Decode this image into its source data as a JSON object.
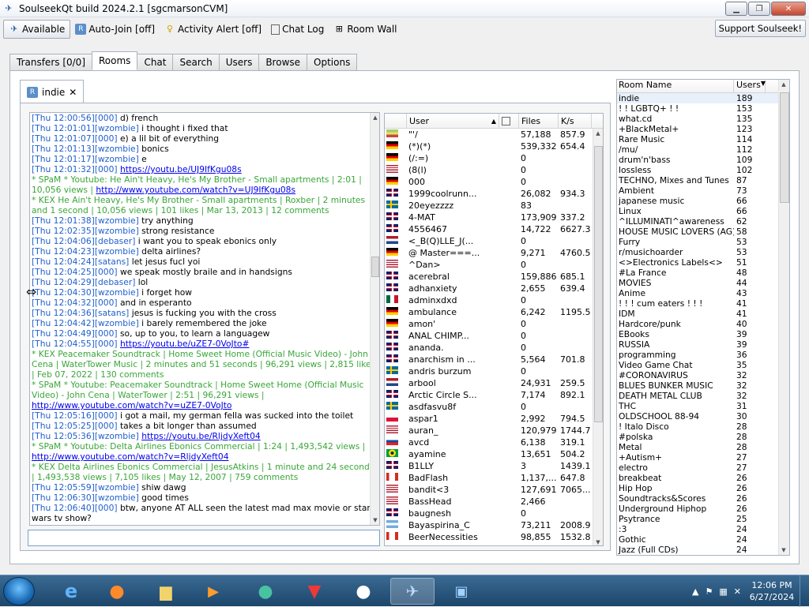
{
  "window": {
    "title": "SoulseekQt build 2024.2.1 [sgcmarsonCVM]",
    "controls": {
      "minimize": "▁",
      "maximize": "❐",
      "close": "✕"
    }
  },
  "toolbar": {
    "status": "Available",
    "autojoin": "Auto-Join [off]",
    "alert": "Activity Alert [off]",
    "chatlog": "Chat Log",
    "roomwall": "Room Wall",
    "support": "Support Soulseek!"
  },
  "tabs": [
    "Transfers [0/0]",
    "Rooms",
    "Chat",
    "Search",
    "Users",
    "Browse",
    "Options"
  ],
  "active_tab": "Rooms",
  "room_tab": {
    "name": "indie",
    "close": "✕"
  },
  "chat_lines": [
    {
      "t": "[Thu 12:00:56]",
      "n": "[000]",
      "m": " d) french"
    },
    {
      "t": "[Thu 12:01:01]",
      "n": "[wzombie]",
      "m": " i thought i fixed that"
    },
    {
      "t": "[Thu 12:01:07]",
      "n": "[000]",
      "m": " e) a lil bit of everything"
    },
    {
      "t": "[Thu 12:01:13]",
      "n": "[wzombie]",
      "m": " bonics"
    },
    {
      "t": "[Thu 12:01:17]",
      "n": "[wzombie]",
      "m": " e"
    },
    {
      "t": "[Thu 12:01:32]",
      "n": "[000]",
      "m": " ",
      "l": "https://youtu.be/UJ9IfKgu08s"
    },
    {
      "s": "* SPaM * Youtube: He Ain't Heavy, He's My Brother - Small apartments | 2:01 | 10,056 views | ",
      "l": "http://www.youtube.com/watch?v=UJ9IfKgu08s"
    },
    {
      "s": "* KEX He Ain't Heavy, He's My Brother - Small apartments | Roxber | 2 minutes and 1 second | 10,056 views | 101 likes | Mar 13, 2013 | 12 comments"
    },
    {
      "t": "[Thu 12:01:38]",
      "n": "[wzombie]",
      "m": " try anything"
    },
    {
      "t": "[Thu 12:02:35]",
      "n": "[wzombie]",
      "m": " strong resistance"
    },
    {
      "t": "[Thu 12:04:06]",
      "n": "[debaser]",
      "m": " i want you to speak ebonics only"
    },
    {
      "t": "[Thu 12:04:23]",
      "n": "[wzombie]",
      "m": " delta airlines?"
    },
    {
      "t": "[Thu 12:04:24]",
      "n": "[satans]",
      "m": " let jesus fucl yoi"
    },
    {
      "t": "[Thu 12:04:25]",
      "n": "[000]",
      "m": " we speak mostly braile and in handsigns"
    },
    {
      "t": "[Thu 12:04:29]",
      "n": "[debaser]",
      "m": " lol"
    },
    {
      "t": "[Thu 12:04:30]",
      "n": "[wzombie]",
      "m": " i forget how"
    },
    {
      "t": "[Thu 12:04:32]",
      "n": "[000]",
      "m": " and in esperanto"
    },
    {
      "t": "[Thu 12:04:36]",
      "n": "[satans]",
      "m": " jesus is fucking you with the cross"
    },
    {
      "t": "[Thu 12:04:42]",
      "n": "[wzombie]",
      "m": " i barely remembered the joke"
    },
    {
      "t": "[Thu 12:04:49]",
      "n": "[000]",
      "m": " so, up to you, to learn a languagew"
    },
    {
      "t": "[Thu 12:04:55]",
      "n": "[000]",
      "m": " ",
      "l": "https://youtu.be/uZE7-0VoJto#"
    },
    {
      "s": "* KEX Peacemaker Soundtrack | Home Sweet Home (Official Music Video) - John Cena | WaterTower Music | 2 minutes and 51 seconds | 96,291 views | 2,815 likes | Feb 07, 2022 | 130 comments"
    },
    {
      "s": "* SPaM * Youtube: Peacemaker Soundtrack | Home Sweet Home (Official Music Video) - John Cena | WaterTower | 2:51 | 96,291 views | ",
      "l": "http://www.youtube.com/watch?v=uZE7-0VoJto"
    },
    {
      "t": "[Thu 12:05:16]",
      "n": "[000]",
      "m": " i got a mail, my german fella was sucked into the toilet"
    },
    {
      "t": "[Thu 12:05:25]",
      "n": "[000]",
      "m": " takes a bit longer than assumed"
    },
    {
      "t": "[Thu 12:05:36]",
      "n": "[wzombie]",
      "m": " ",
      "l": "https://youtu.be/RljdyXeft04"
    },
    {
      "s": "* SPaM * Youtube: Delta Airlines Ebonics Commercial | 1:24 | 1,493,542 views | ",
      "l": "http://www.youtube.com/watch?v=RljdyXeft04"
    },
    {
      "s": "* KEX Delta Airlines Ebonics Commercial | JesusAtkins | 1 minute and 24 seconds | 1,493,538 views | 7,105 likes | May 12, 2007 | 759 comments"
    },
    {
      "t": "[Thu 12:05:59]",
      "n": "[wzombie]",
      "m": " shiw dawg"
    },
    {
      "t": "[Thu 12:06:30]",
      "n": "[wzombie]",
      "m": " good times"
    },
    {
      "t": "[Thu 12:06:40]",
      "n": "[000]",
      "m": " btw, anyone AT ALL seen the latest mad max movie or star wars tv show?"
    }
  ],
  "users_headers": {
    "user": "User",
    "files": "Files",
    "speed": "K/s"
  },
  "users": [
    {
      "f": "#",
      "u": "\"'/",
      "fi": "57,188",
      "k": "857.9"
    },
    {
      "f": "de",
      "u": "(*)(*)",
      "fi": "539,332",
      "k": "654.4"
    },
    {
      "f": "de",
      "u": "(/:=)",
      "fi": "0",
      "k": ""
    },
    {
      "f": "us",
      "u": "(8(l)",
      "fi": "0",
      "k": ""
    },
    {
      "f": "de",
      "u": "000",
      "fi": "0",
      "k": ""
    },
    {
      "f": "gb",
      "u": "1999coolrunn...",
      "fi": "26,082",
      "k": "934.3"
    },
    {
      "f": "se",
      "u": "20eyezzzz",
      "fi": "83",
      "k": ""
    },
    {
      "f": "gb",
      "u": "4-MAT",
      "fi": "173,909",
      "k": "337.2"
    },
    {
      "f": "gb",
      "u": "4556467",
      "fi": "14,722",
      "k": "6627.3"
    },
    {
      "f": "nl",
      "u": "<_B(Q)LLE_J(...",
      "fi": "0",
      "k": ""
    },
    {
      "f": "de",
      "u": "@ Master===...",
      "fi": "9,271",
      "k": "4760.5"
    },
    {
      "f": "us",
      "u": "^Dan>",
      "fi": "0",
      "k": ""
    },
    {
      "f": "gb",
      "u": "acerebral",
      "fi": "159,886",
      "k": "685.1"
    },
    {
      "f": "gb",
      "u": "adhanxiety",
      "fi": "2,655",
      "k": "639.4"
    },
    {
      "f": "mx",
      "u": "adminxdxd",
      "fi": "0",
      "k": ""
    },
    {
      "f": "de",
      "u": "ambulance",
      "fi": "6,242",
      "k": "1195.5"
    },
    {
      "f": "de",
      "u": "amon'",
      "fi": "0",
      "k": ""
    },
    {
      "f": "gb",
      "u": "ANAL CHIMP...",
      "fi": "0",
      "k": ""
    },
    {
      "f": "gb",
      "u": "ananda.",
      "fi": "0",
      "k": ""
    },
    {
      "f": "gb",
      "u": "anarchism in ...",
      "fi": "5,564",
      "k": "701.8"
    },
    {
      "f": "se",
      "u": "andris burzum",
      "fi": "0",
      "k": ""
    },
    {
      "f": "nl",
      "u": "arbool",
      "fi": "24,931",
      "k": "259.5"
    },
    {
      "f": "gb",
      "u": "Arctic Circle S...",
      "fi": "7,174",
      "k": "892.1"
    },
    {
      "f": "se",
      "u": "asdfasvu8f",
      "fi": "0",
      "k": ""
    },
    {
      "f": "pl",
      "u": "aspar1",
      "fi": "2,992",
      "k": "794.5"
    },
    {
      "f": "us",
      "u": "auran_",
      "fi": "120,979",
      "k": "1744.7"
    },
    {
      "f": "sk",
      "u": "avcd",
      "fi": "6,138",
      "k": "319.1"
    },
    {
      "f": "br",
      "u": "ayamine",
      "fi": "13,651",
      "k": "504.2"
    },
    {
      "f": "gb",
      "u": "B1LLY",
      "fi": "3",
      "k": "1439.1"
    },
    {
      "f": "ca",
      "u": "BadFlash",
      "fi": "1,137,...",
      "k": "647.8"
    },
    {
      "f": "us",
      "u": "bandit<3",
      "fi": "127,691",
      "k": "7065..."
    },
    {
      "f": "us",
      "u": "BassHead",
      "fi": "2,466",
      "k": ""
    },
    {
      "f": "gb",
      "u": "baugnesh",
      "fi": "0",
      "k": ""
    },
    {
      "f": "ar",
      "u": "Bayaspirina_C",
      "fi": "73,211",
      "k": "2008.9"
    },
    {
      "f": "ca",
      "u": "BeerNecessities",
      "fi": "98,855",
      "k": "1532.8"
    }
  ],
  "rooms_headers": {
    "name": "Room Name",
    "users": "Users"
  },
  "rooms": [
    [
      "indie",
      "189"
    ],
    [
      "! ! LGBTQ+ ! !",
      "153"
    ],
    [
      "what.cd",
      "135"
    ],
    [
      "+BlackMetal+",
      "123"
    ],
    [
      "Rare Music",
      "114"
    ],
    [
      "/mu/",
      "112"
    ],
    [
      "drum'n'bass",
      "109"
    ],
    [
      "lossless",
      "102"
    ],
    [
      "TECHNO, Mixes and Tunes",
      "87"
    ],
    [
      "Ambient",
      "73"
    ],
    [
      "japanese music",
      "66"
    ],
    [
      "Linux",
      "66"
    ],
    [
      "^ILLUMINATI^awareness",
      "62"
    ],
    [
      "HOUSE MUSIC LOVERS (AG)",
      "58"
    ],
    [
      "Furry",
      "53"
    ],
    [
      "r/musichoarder",
      "53"
    ],
    [
      "<>Electronics Labels<>",
      "51"
    ],
    [
      "#La France",
      "48"
    ],
    [
      "MOVIES",
      "44"
    ],
    [
      "Anime",
      "43"
    ],
    [
      "! ! ! cum eaters ! ! !",
      "41"
    ],
    [
      "IDM",
      "41"
    ],
    [
      "Hardcore/punk",
      "40"
    ],
    [
      "EBooks",
      "39"
    ],
    [
      "RUSSIA",
      "39"
    ],
    [
      "programming",
      "36"
    ],
    [
      "Video Game Chat",
      "35"
    ],
    [
      "#CORONAVIRUS",
      "32"
    ],
    [
      "BLUES BUNKER MUSIC",
      "32"
    ],
    [
      "DEATH METAL CLUB",
      "32"
    ],
    [
      "THC",
      "31"
    ],
    [
      "OLDSCHOOL 88-94",
      "30"
    ],
    [
      "! Italo Disco",
      "28"
    ],
    [
      "#polska",
      "28"
    ],
    [
      "Metal",
      "28"
    ],
    [
      "+Autism+",
      "27"
    ],
    [
      "electro",
      "27"
    ],
    [
      "breakbeat",
      "26"
    ],
    [
      "Hip Hop",
      "26"
    ],
    [
      "Soundtracks&Scores",
      "26"
    ],
    [
      "Underground Hiphop",
      "26"
    ],
    [
      "Psytrance",
      "25"
    ],
    [
      ":3",
      "24"
    ],
    [
      "Gothic",
      "24"
    ],
    [
      "Jazz (Full CDs)",
      "24"
    ]
  ],
  "taskbar": {
    "time": "12:06 PM",
    "date": "6/27/2024"
  },
  "colors": {
    "timestamp": "#1f5fcc",
    "spam": "#3aa63a",
    "link": "#0000ee"
  }
}
